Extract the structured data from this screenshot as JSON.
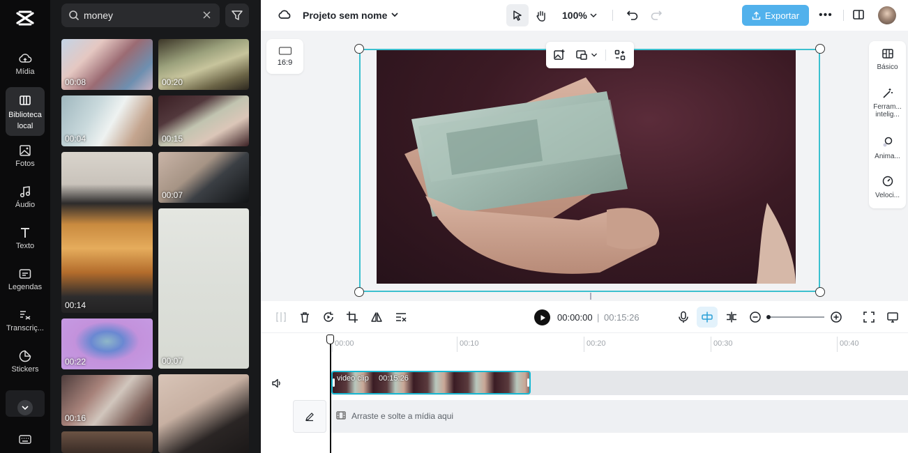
{
  "rail": {
    "items": [
      {
        "label": "Mídia",
        "icon": "cloud-upload-icon"
      },
      {
        "label": "Biblioteca local",
        "icon": "library-icon"
      },
      {
        "label": "Fotos",
        "icon": "image-icon"
      },
      {
        "label": "Áudio",
        "icon": "music-note-icon"
      },
      {
        "label": "Texto",
        "icon": "text-icon"
      },
      {
        "label": "Legendas",
        "icon": "captions-icon"
      },
      {
        "label": "Transcriç...",
        "icon": "transcript-icon"
      },
      {
        "label": "Stickers",
        "icon": "sticker-icon"
      }
    ]
  },
  "panel": {
    "search_value": "money",
    "thumbs": [
      {
        "duration": "00:08"
      },
      {
        "duration": "00:20"
      },
      {
        "duration": "00:04"
      },
      {
        "duration": "00:15"
      },
      {
        "duration": "00:14"
      },
      {
        "duration": "00:07"
      },
      {
        "duration": "00:07"
      },
      {
        "duration": "00:22"
      },
      {
        "duration": "00:16"
      }
    ]
  },
  "topbar": {
    "project_name": "Projeto sem nome",
    "zoom": "100%",
    "export_label": "Exportar"
  },
  "stage": {
    "aspect_label": "16:9"
  },
  "right_panel": {
    "items": [
      {
        "label": "Básico"
      },
      {
        "label": "Ferram... intelig..."
      },
      {
        "label": "Anima..."
      },
      {
        "label": "Veloci..."
      }
    ]
  },
  "playback": {
    "current_time": "00:00:00",
    "separator": "|",
    "total_time": "00:15:26"
  },
  "timeline": {
    "ticks": [
      "00:00",
      "00:10",
      "00:20",
      "00:30",
      "00:40"
    ],
    "clip_name": "video clip",
    "clip_duration": "00:15:26",
    "drop_hint": "Arraste e solte a mídia aqui"
  },
  "colors": {
    "accent": "#4db3e6",
    "selection": "#3cc0cf",
    "clip_border": "#19b8d2",
    "export_bg": "#51b1ec"
  }
}
